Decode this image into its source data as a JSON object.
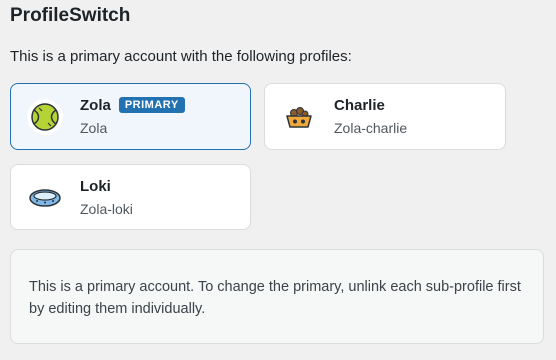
{
  "app": {
    "title": "ProfileSwitch"
  },
  "intro": "This is a primary account with the following profiles:",
  "profiles": [
    {
      "name": "Zola",
      "slug": "Zola",
      "badge": "PRIMARY",
      "icon": "tennis-ball-icon",
      "is_primary": true
    },
    {
      "name": "Charlie",
      "slug": "Zola-charlie",
      "icon": "pet-food-bowl-icon",
      "is_primary": false
    },
    {
      "name": "Loki",
      "slug": "Zola-loki",
      "icon": "pet-bed-icon",
      "is_primary": false
    }
  ],
  "notice": "This is a primary account. To change the primary, unlink each sub-profile first by editing them individually.",
  "colors": {
    "accent": "#2271b1",
    "primary_card_bg": "#f0f6fc",
    "page_bg": "#f0f0f1"
  }
}
